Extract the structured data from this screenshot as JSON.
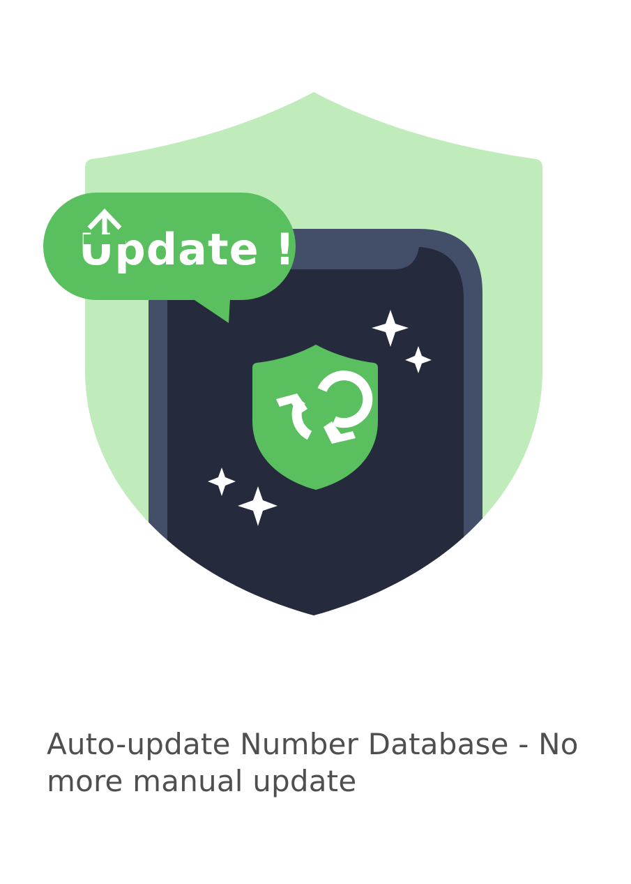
{
  "illustration": {
    "badge_text": "Update !",
    "icons": [
      "large-shield",
      "phone",
      "update-speech-bubble",
      "up-arrow-icon",
      "shield-sync-icon",
      "sparkle-icon"
    ],
    "colors": {
      "light_green": "#c0ebbb",
      "green": "#5abf5e",
      "phone_frame": "#434e68",
      "phone_screen": "#252b3c",
      "white": "#ffffff"
    }
  },
  "caption": {
    "text": "Auto-update Number Database - No more manual update",
    "color": "#4f4f4f"
  }
}
